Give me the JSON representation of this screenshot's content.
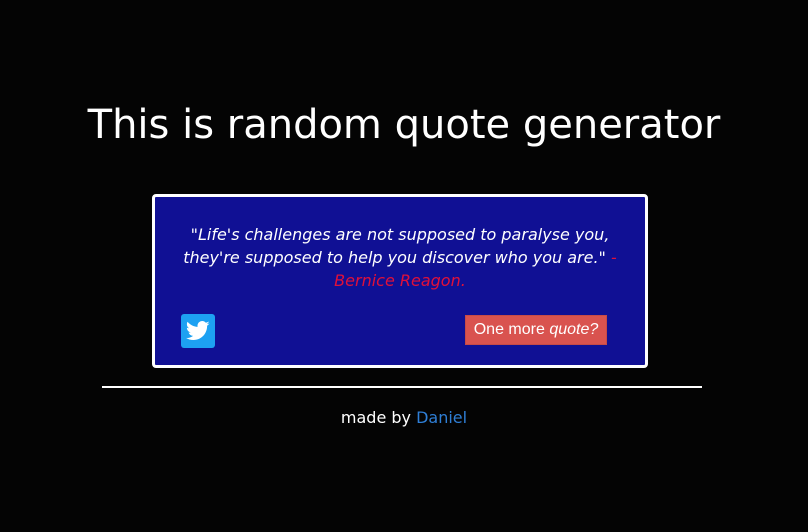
{
  "header": {
    "title": "This is random quote generator"
  },
  "quote": {
    "text": "\"Life's challenges are not supposed to paralyse you, they're supposed to help you discover who you are.\"",
    "author": "- Bernice Reagon."
  },
  "actions": {
    "tweet_icon": "twitter-icon",
    "new_quote_prefix": "One more ",
    "new_quote_emphasis": "quote?"
  },
  "footer": {
    "made_by_label": "made by",
    "author_link": "Daniel"
  },
  "colors": {
    "background": "#040404",
    "quote_box": "#101094",
    "author_accent": "#e0103a",
    "button": "#d9534f",
    "twitter": "#1da1f2",
    "link": "#2f7fd6"
  }
}
